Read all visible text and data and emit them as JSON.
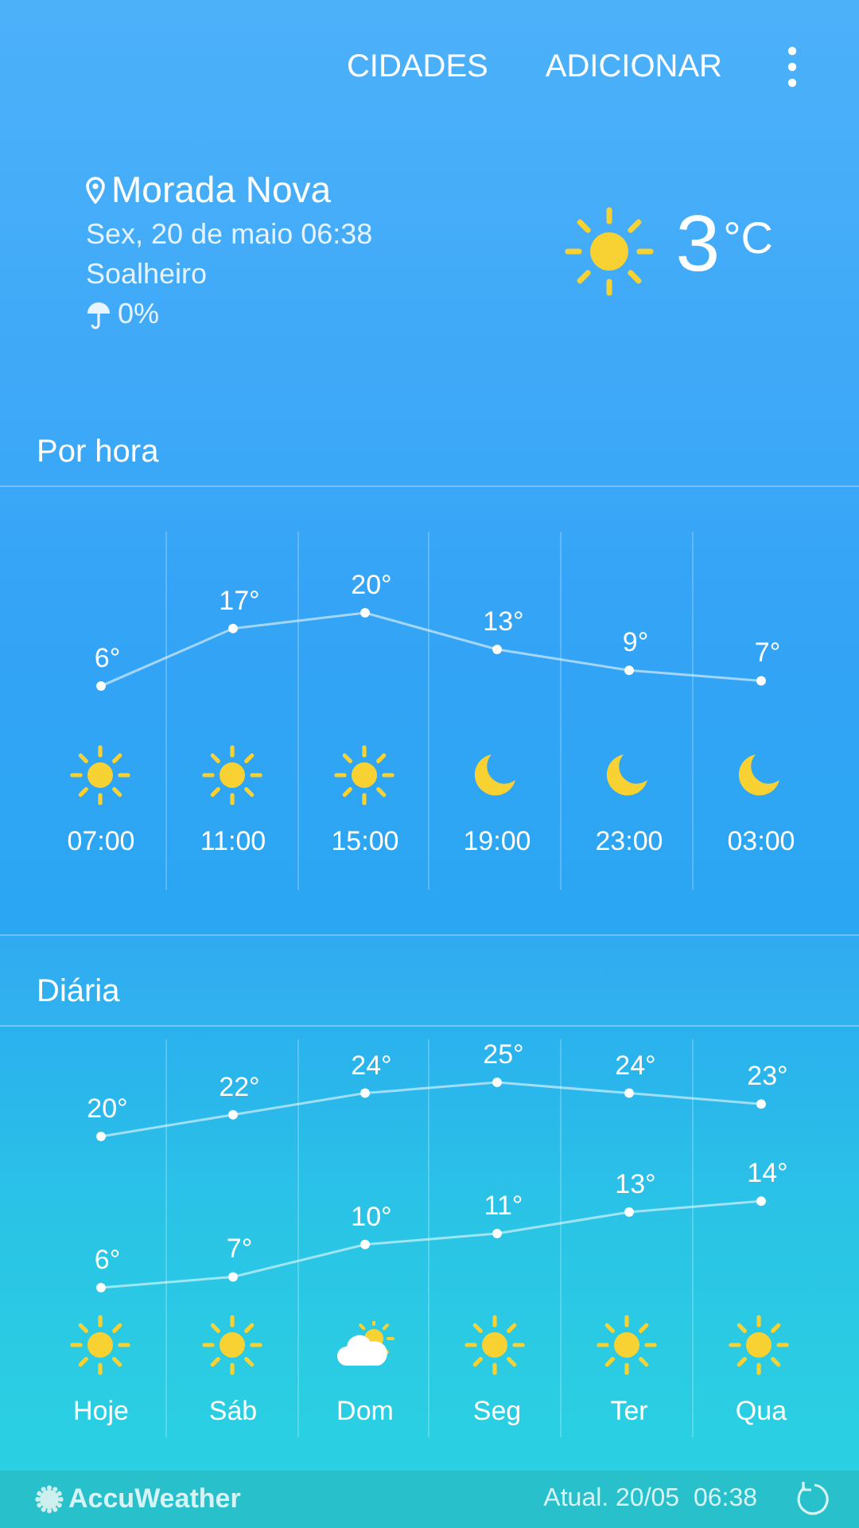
{
  "top_bar": {
    "buttons": [
      "CIDADES",
      "ADICIONAR"
    ]
  },
  "current": {
    "location": "Morada Nova",
    "datetime": "Sex, 20 de maio 06:38",
    "condition": "Soalheiro",
    "precipitation": "0%",
    "temperature": "3",
    "unit": "°C",
    "kind": "sun"
  },
  "hourly": {
    "title": "Por hora",
    "icons": [
      {
        "kind": "sun"
      },
      {
        "kind": "sun"
      },
      {
        "kind": "sun"
      },
      {
        "kind": "moon"
      },
      {
        "kind": "moon"
      },
      {
        "kind": "moon"
      }
    ],
    "chart_data": {
      "type": "line",
      "categories": [
        "07:00",
        "11:00",
        "15:00",
        "19:00",
        "23:00",
        "03:00"
      ],
      "series": [
        {
          "color": "#ffffff",
          "marker": "circle",
          "values": [
            6,
            17,
            20,
            13,
            9,
            7
          ],
          "value_labels": [
            "6°",
            "17°",
            "20°",
            "13°",
            "9°",
            "7°"
          ]
        }
      ]
    }
  },
  "daily": {
    "title": "Diária",
    "icons": [
      {
        "kind": "sun"
      },
      {
        "kind": "sun"
      },
      {
        "kind": "cloud-sun"
      },
      {
        "kind": "sun"
      },
      {
        "kind": "sun"
      },
      {
        "kind": "sun"
      }
    ],
    "chart_data": {
      "type": "line",
      "categories": [
        "Hoje",
        "Sáb",
        "Dom",
        "Seg",
        "Ter",
        "Qua"
      ],
      "series": [
        {
          "color": "#ffffff",
          "marker": "circle",
          "values": [
            20,
            22,
            24,
            25,
            24,
            23
          ],
          "value_labels": [
            "20°",
            "22°",
            "24°",
            "25°",
            "24°",
            "23°"
          ]
        },
        {
          "color": "#ffffff",
          "marker": "circle",
          "values": [
            6,
            7,
            10,
            11,
            13,
            14
          ],
          "value_labels": [
            "6°",
            "7°",
            "10°",
            "11°",
            "13°",
            "14°"
          ]
        }
      ]
    }
  },
  "footer": {
    "brand": "AccuWeather",
    "updated": "Atual. 20/05  06:38"
  }
}
